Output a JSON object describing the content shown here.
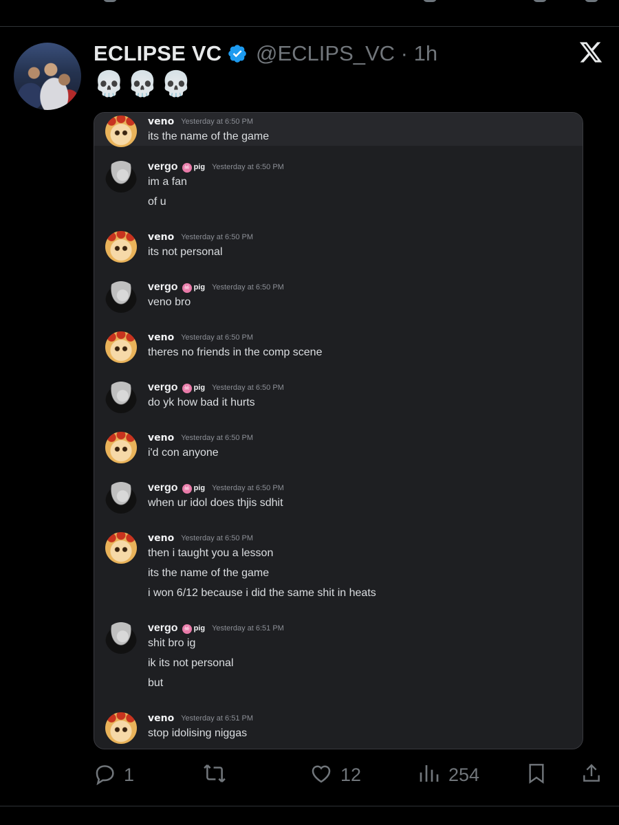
{
  "tweet": {
    "display_name": "ECLIPSE VC",
    "handle_time": "@ECLIPS_VC · 1h",
    "text": "💀💀💀",
    "replies": "1",
    "likes": "12",
    "views": "254"
  },
  "icons": {
    "verified": "verified-badge-icon",
    "close": "x-logo-icon",
    "reply": "reply-icon",
    "retweet": "retweet-icon",
    "like": "heart-icon",
    "views": "views-bars-icon",
    "bookmark": "bookmark-icon",
    "share": "share-icon"
  },
  "colors": {
    "verified": "#1d9bf0",
    "discord_bg": "#1e1f22",
    "tag_pink": "#e87aa8"
  },
  "discord": {
    "messages": [
      {
        "author": "veno",
        "tag": "",
        "time": "Yesterday at 6:50 PM",
        "lines": [
          "its the name of the game"
        ]
      },
      {
        "author": "vergo",
        "tag": "pig",
        "time": "Yesterday at 6:50 PM",
        "lines": [
          "im a fan",
          "of u"
        ]
      },
      {
        "author": "veno",
        "tag": "",
        "time": "Yesterday at 6:50 PM",
        "lines": [
          "its not personal"
        ]
      },
      {
        "author": "vergo",
        "tag": "pig",
        "time": "Yesterday at 6:50 PM",
        "lines": [
          "veno bro"
        ]
      },
      {
        "author": "veno",
        "tag": "",
        "time": "Yesterday at 6:50 PM",
        "lines": [
          "theres no friends in the comp scene"
        ]
      },
      {
        "author": "vergo",
        "tag": "pig",
        "time": "Yesterday at 6:50 PM",
        "lines": [
          "do yk how bad it hurts"
        ]
      },
      {
        "author": "veno",
        "tag": "",
        "time": "Yesterday at 6:50 PM",
        "lines": [
          "i'd con anyone"
        ]
      },
      {
        "author": "vergo",
        "tag": "pig",
        "time": "Yesterday at 6:50 PM",
        "lines": [
          "when ur idol does thjis sdhit"
        ]
      },
      {
        "author": "veno",
        "tag": "",
        "time": "Yesterday at 6:50 PM",
        "lines": [
          "then i taught you a lesson",
          "its the name of the game",
          "i won 6/12 because i did the same shit in heats"
        ]
      },
      {
        "author": "vergo",
        "tag": "pig",
        "time": "Yesterday at 6:51 PM",
        "lines": [
          "shit bro ig",
          "ik its not personal",
          "but"
        ]
      },
      {
        "author": "veno",
        "tag": "",
        "time": "Yesterday at 6:51 PM",
        "lines": [
          "stop idolising niggas"
        ]
      }
    ]
  }
}
